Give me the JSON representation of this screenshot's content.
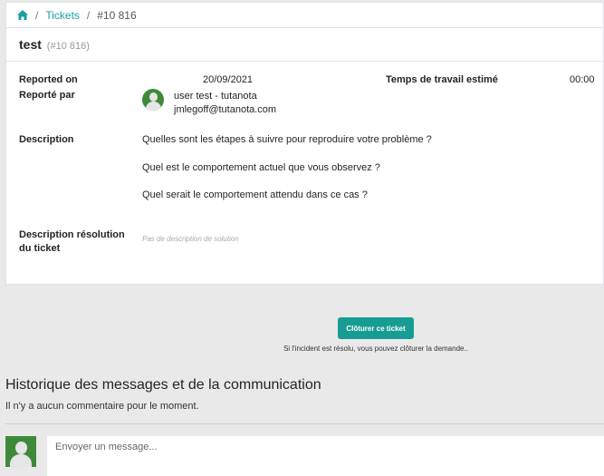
{
  "breadcrumb": {
    "home_icon": "home-icon",
    "tickets_label": "Tickets",
    "separator": "/",
    "current": "#10 816"
  },
  "ticket": {
    "title": "test",
    "number": "(#10 816)"
  },
  "fields": {
    "reported_on_label": "Reported on",
    "reported_on_value": "20/09/2021",
    "estimated_time_label": "Temps de travail estimé",
    "estimated_time_value": "00:00",
    "reported_by_label": "Reporté par",
    "reporter_name": "user test - tutanota",
    "reporter_email": "jmlegoff@tutanota.com",
    "description_label": "Description",
    "description_lines": [
      "Quelles sont les étapes à suivre pour reproduire votre problème ?",
      "Quel est le comportement actuel que vous observez ?",
      "Quel serait le comportement attendu dans ce cas ?"
    ],
    "resolution_label_line1": "Description résolution",
    "resolution_label_line2": "du ticket",
    "resolution_value": "Pas de description de solution"
  },
  "actions": {
    "close_button": "Clôturer ce ticket",
    "close_hint": "Si l'incident est résolu, vous pouvez clôturer la demande.."
  },
  "history": {
    "title": "Historique des messages et de la communication",
    "empty_text": "Il n'y a aucun commentaire pour le moment.",
    "message_placeholder": "Envoyer un message..."
  },
  "colors": {
    "accent": "#179c93",
    "link": "#1a9ea0",
    "avatar_bg": "#3f8a3a"
  }
}
